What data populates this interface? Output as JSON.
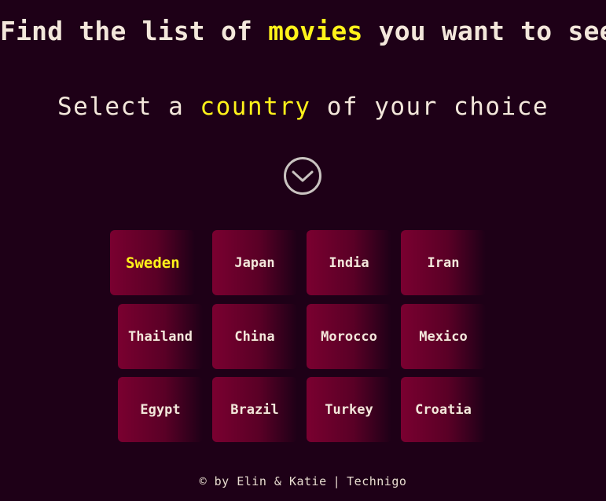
{
  "header": {
    "title_before": "Find the list of ",
    "title_highlight": "movies",
    "title_after": " you want to see",
    "subtitle_before": "Select a ",
    "subtitle_highlight": "country",
    "subtitle_after": " of your choice"
  },
  "scroll_icon": "chevron-down-circle-icon",
  "countries": {
    "selected": "Sweden",
    "row1": [
      "Sweden",
      "Japan",
      "India",
      "Iran"
    ],
    "row2": [
      "Thailand",
      "China",
      "Morocco",
      "Mexico"
    ],
    "row3": [
      "Egypt",
      "Brazil",
      "Turkey",
      "Croatia"
    ]
  },
  "footer": {
    "credit": "© by Elin & Katie",
    "separator": "|",
    "org": "Technigo"
  },
  "colors": {
    "background": "#1e0017",
    "highlight": "#fff21a",
    "text": "#f3e7db",
    "card": "#7a0030"
  }
}
